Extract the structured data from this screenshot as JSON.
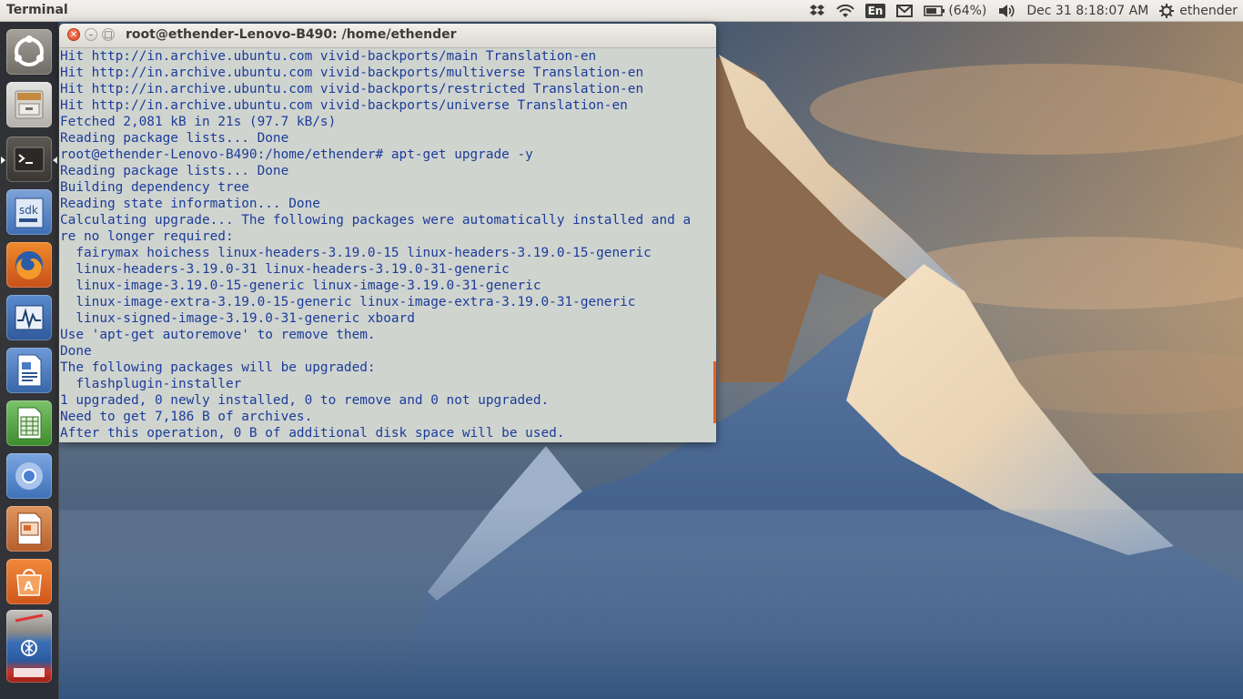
{
  "top_panel": {
    "app_title": "Terminal",
    "keyboard_layout": "En",
    "battery": "(64%)",
    "clock": "Dec 31  8:18:07 AM",
    "user": "ethender"
  },
  "launcher": {
    "items": [
      {
        "name": "ubuntu-dash-icon"
      },
      {
        "name": "files-icon"
      },
      {
        "name": "terminal-icon",
        "active": true
      },
      {
        "name": "sdk-manager-icon",
        "label": "sdk"
      },
      {
        "name": "firefox-icon"
      },
      {
        "name": "system-monitor-icon"
      },
      {
        "name": "libreoffice-writer-icon"
      },
      {
        "name": "libreoffice-calc-icon"
      },
      {
        "name": "chromium-icon"
      },
      {
        "name": "libreoffice-impress-icon"
      },
      {
        "name": "software-center-icon"
      },
      {
        "name": "launcher-overflow-icon"
      }
    ]
  },
  "terminal": {
    "title": "root@ethender-Lenovo-B490: /home/ethender",
    "lines": [
      "Hit http://in.archive.ubuntu.com vivid-backports/main Translation-en",
      "Hit http://in.archive.ubuntu.com vivid-backports/multiverse Translation-en",
      "Hit http://in.archive.ubuntu.com vivid-backports/restricted Translation-en",
      "Hit http://in.archive.ubuntu.com vivid-backports/universe Translation-en",
      "Fetched 2,081 kB in 21s (97.7 kB/s)",
      "Reading package lists... Done",
      "root@ethender-Lenovo-B490:/home/ethender# apt-get upgrade -y",
      "Reading package lists... Done",
      "Building dependency tree",
      "Reading state information... Done",
      "Calculating upgrade... The following packages were automatically installed and a",
      "re no longer required:",
      "  fairymax hoichess linux-headers-3.19.0-15 linux-headers-3.19.0-15-generic",
      "  linux-headers-3.19.0-31 linux-headers-3.19.0-31-generic",
      "  linux-image-3.19.0-15-generic linux-image-3.19.0-31-generic",
      "  linux-image-extra-3.19.0-15-generic linux-image-extra-3.19.0-31-generic",
      "  linux-signed-image-3.19.0-31-generic xboard",
      "Use 'apt-get autoremove' to remove them.",
      "Done",
      "The following packages will be upgraded:",
      "  flashplugin-installer",
      "1 upgraded, 0 newly installed, 0 to remove and 0 not upgraded.",
      "Need to get 7,186 B of archives.",
      "After this operation, 0 B of additional disk space will be used."
    ]
  },
  "colors": {
    "terminal_text": "#1c3c9a",
    "terminal_bg": "#cfd4cf",
    "close_button": "#e0451f",
    "scroll_marker": "#e85e26"
  }
}
